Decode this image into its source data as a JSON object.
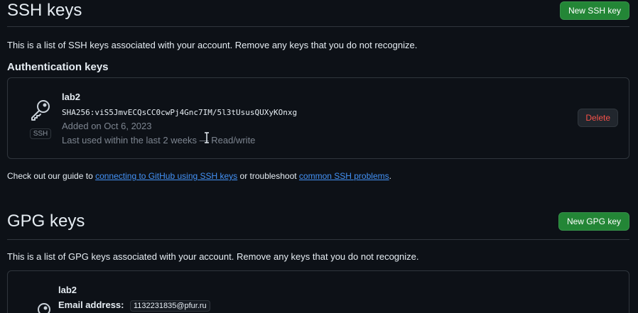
{
  "ssh": {
    "title": "SSH keys",
    "new_button": "New SSH key",
    "description": "This is a list of SSH keys associated with your account. Remove any keys that you do not recognize.",
    "auth_heading": "Authentication keys",
    "key": {
      "name": "lab2",
      "fingerprint": "SHA256:viS5JmvECQsCC0cwPj4Gnc7IM/5l3tUsusQUXyKOnxg",
      "added": "Added on Oct 6, 2023",
      "last_used": "Last used within the last 2 weeks — Read/write",
      "type_badge": "SSH",
      "delete_label": "Delete",
      "icon": "key-icon"
    },
    "guide": {
      "prefix": "Check out our guide to ",
      "link1": "connecting to GitHub using SSH keys",
      "middle": " or troubleshoot ",
      "link2": "common SSH problems",
      "suffix": "."
    }
  },
  "gpg": {
    "title": "GPG keys",
    "new_button": "New GPG key",
    "description": "This is a list of GPG keys associated with your account. Remove any keys that you do not recognize.",
    "key": {
      "name": "lab2",
      "email_label": "Email address:",
      "email_value": "1132231835@pfur.ru",
      "icon": "key-icon"
    }
  },
  "colors": {
    "background": "#0d1117",
    "border": "#30363d",
    "primary_button": "#238636",
    "danger_text": "#f85149",
    "link": "#4493f8",
    "muted_text": "#7d8590"
  }
}
